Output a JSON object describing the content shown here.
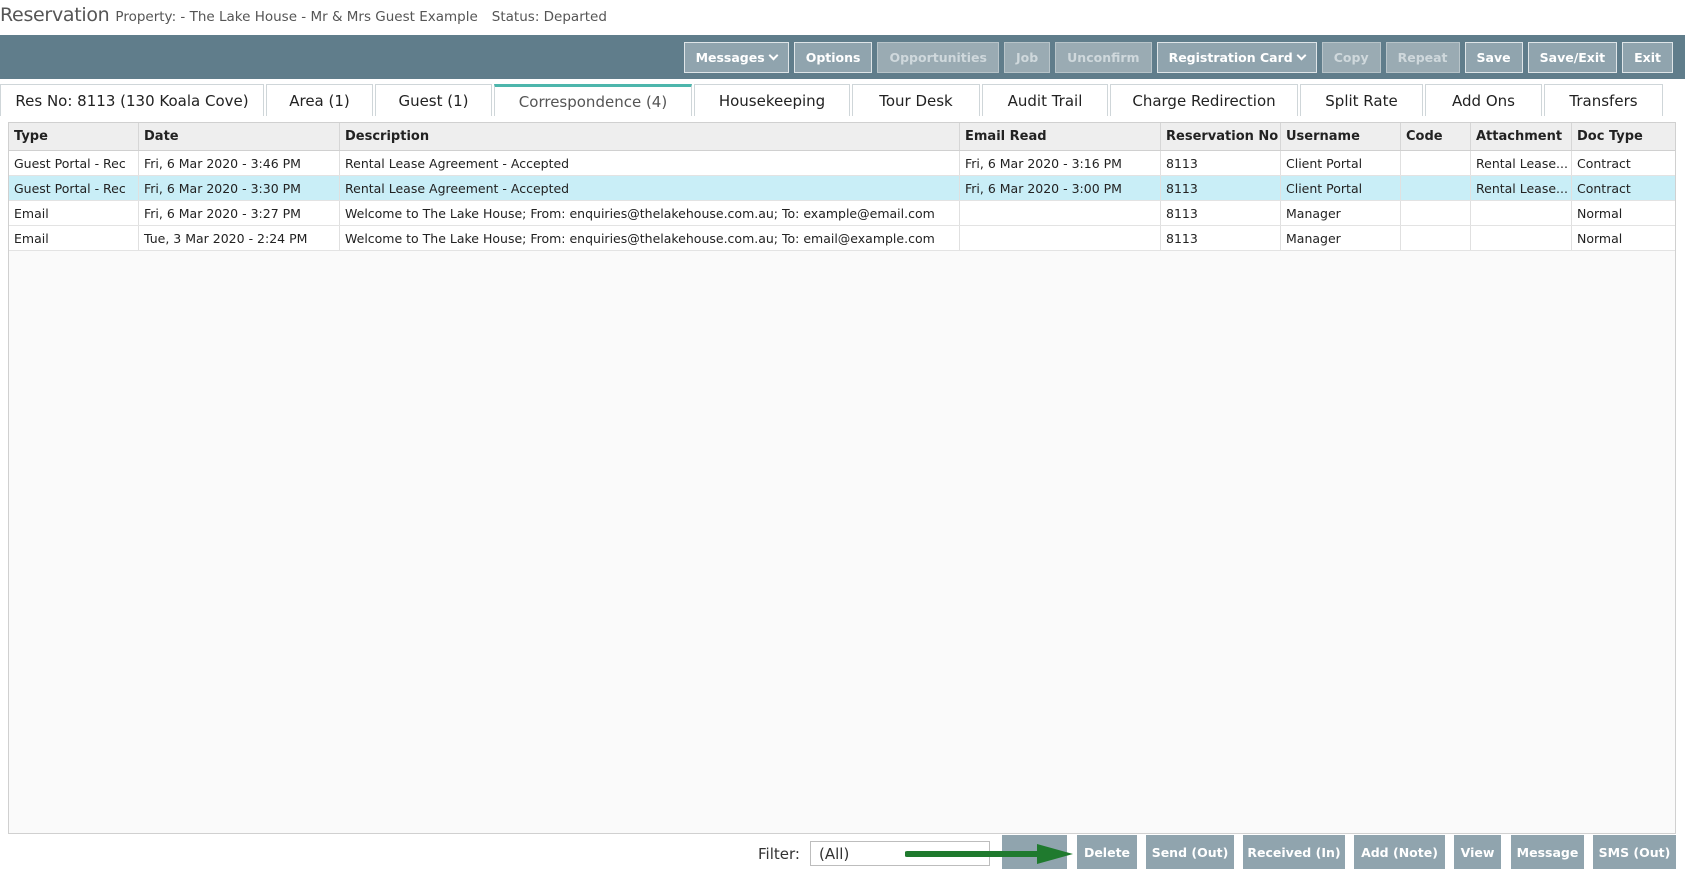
{
  "header": {
    "title": "Reservation",
    "property": "Property: - The Lake House -  Mr & Mrs Guest Example",
    "status": "Status: Departed"
  },
  "toolbar": {
    "messages": "Messages",
    "options": "Options",
    "opportunities": "Opportunities",
    "job": "Job",
    "unconfirm": "Unconfirm",
    "registration_card": "Registration Card",
    "copy": "Copy",
    "repeat": "Repeat",
    "save": "Save",
    "save_exit": "Save/Exit",
    "exit": "Exit"
  },
  "tabs": [
    {
      "label": "Res No: 8113 (130 Koala Cove)"
    },
    {
      "label": "Area (1)"
    },
    {
      "label": "Guest (1)"
    },
    {
      "label": "Correspondence (4)"
    },
    {
      "label": "Housekeeping"
    },
    {
      "label": "Tour Desk"
    },
    {
      "label": "Audit Trail"
    },
    {
      "label": "Charge Redirection"
    },
    {
      "label": "Split Rate"
    },
    {
      "label": "Add Ons"
    },
    {
      "label": "Transfers"
    }
  ],
  "grid": {
    "columns": [
      "Type",
      "Date",
      "Description",
      "Email Read",
      "Reservation No",
      "Username",
      "Code",
      "Attachment",
      "Doc Type"
    ],
    "rows": [
      [
        "Guest Portal - Rec",
        "Fri, 6 Mar 2020 - 3:46 PM",
        "Rental Lease Agreement - Accepted",
        "Fri, 6 Mar 2020 - 3:16 PM",
        "8113",
        "Client Portal",
        "",
        "Rental Lease...",
        "Contract"
      ],
      [
        "Guest Portal - Rec",
        "Fri, 6 Mar 2020 - 3:30 PM",
        "Rental Lease Agreement - Accepted",
        "Fri, 6 Mar 2020 - 3:00 PM",
        "8113",
        "Client Portal",
        "",
        "Rental Lease...",
        "Contract"
      ],
      [
        "Email",
        "Fri, 6 Mar 2020 - 3:27 PM",
        "Welcome to The Lake House; From: enquiries@thelakehouse.com.au; To: example@email.com",
        "",
        "8113",
        "Manager",
        "",
        "",
        "Normal"
      ],
      [
        "Email",
        "Tue, 3 Mar 2020 - 2:24 PM",
        "Welcome to The Lake House; From: enquiries@thelakehouse.com.au; To: email@example.com",
        "",
        "8113",
        "Manager",
        "",
        "",
        "Normal"
      ]
    ]
  },
  "footer": {
    "filter_label": "Filter:",
    "filter_value": "(All)",
    "delete": "Delete",
    "send_out": "Send (Out)",
    "received_in": "Received (In)",
    "add_note": "Add (Note)",
    "view": "View",
    "message": "Message",
    "sms_out": "SMS (Out)"
  },
  "colors": {
    "toolbar_bg": "#607d8b",
    "button_bg": "#90a4ae",
    "active_tab_accent": "#4db6ac",
    "selected_row": "#c9eef7",
    "annotation_arrow": "#1f7a2e"
  },
  "icons": {
    "dropdown": "chevron-down-icon",
    "annotation": "green-arrow-icon"
  }
}
